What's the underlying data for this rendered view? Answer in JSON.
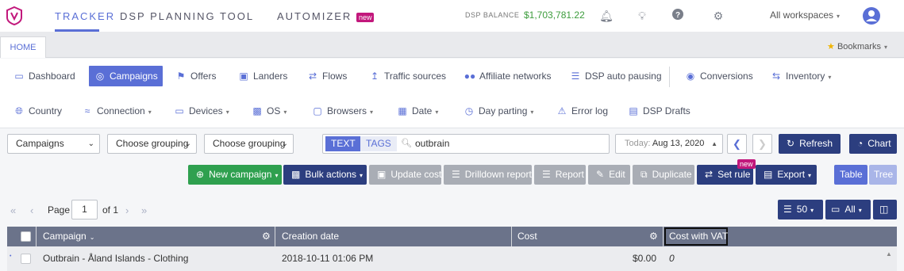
{
  "topnav": {
    "tracker": "TRACKER",
    "dsp_planning": "DSP PLANNING TOOL",
    "automizer": "AUTOMIZER",
    "new_badge": "new",
    "balance_label": "DSP BALANCE",
    "balance_value": "$1,703,781.22",
    "workspaces": "All workspaces",
    "icons": [
      "bell-icon",
      "lightbulb-icon",
      "help-icon",
      "gear-icon",
      "avatar"
    ]
  },
  "tabs": {
    "home": "HOME",
    "bookmarks": "Bookmarks"
  },
  "menu_row1": {
    "dashboard": "Dashboard",
    "campaigns": "Campaigns",
    "offers": "Offers",
    "landers": "Landers",
    "flows": "Flows",
    "traffic_sources": "Traffic sources",
    "affiliate_networks": "Affiliate networks",
    "dsp_auto_pausing": "DSP auto pausing",
    "conversions": "Conversions",
    "inventory": "Inventory"
  },
  "menu_row2": {
    "country": "Country",
    "connection": "Connection",
    "devices": "Devices",
    "os": "OS",
    "browsers": "Browsers",
    "date": "Date",
    "day_parting": "Day parting",
    "error_log": "Error log",
    "dsp_drafts": "DSP Drafts"
  },
  "filters": {
    "entity": "Campaigns",
    "grouping1": "Choose grouping",
    "grouping2": "Choose grouping",
    "text_tab": "TEXT",
    "tags_tab": "TAGS",
    "search_value": "outbrain",
    "date_label": "Today:",
    "date_value": "Aug 13, 2020",
    "refresh": "Refresh",
    "chart": "Chart"
  },
  "actions": {
    "new_campaign": "New campaign",
    "bulk_actions": "Bulk actions",
    "update_cost": "Update cost",
    "drilldown_report": "Drilldown report",
    "report": "Report",
    "edit": "Edit",
    "duplicate": "Duplicate",
    "set_rule": "Set rule",
    "set_rule_badge": "new",
    "export": "Export",
    "table": "Table",
    "tree": "Tree"
  },
  "pagination": {
    "page_label": "Page",
    "page_value": "1",
    "of_label": "of 1",
    "per_page": "50",
    "filter_all": "All"
  },
  "table": {
    "columns": [
      "Campaign",
      "Creation date",
      "Cost",
      "Cost with VAT"
    ],
    "rows": [
      {
        "campaign": "Outbrain - Åland Islands - Clothing",
        "creation_date": "2018-10-11 01:06 PM",
        "cost": "$0.00",
        "cost_vat": "0"
      }
    ]
  },
  "colors": {
    "accent": "#5a6fd6",
    "dark": "#2c3e7f",
    "green": "#2fa04f",
    "badge": "#c2187c",
    "header": "#6b738a"
  }
}
